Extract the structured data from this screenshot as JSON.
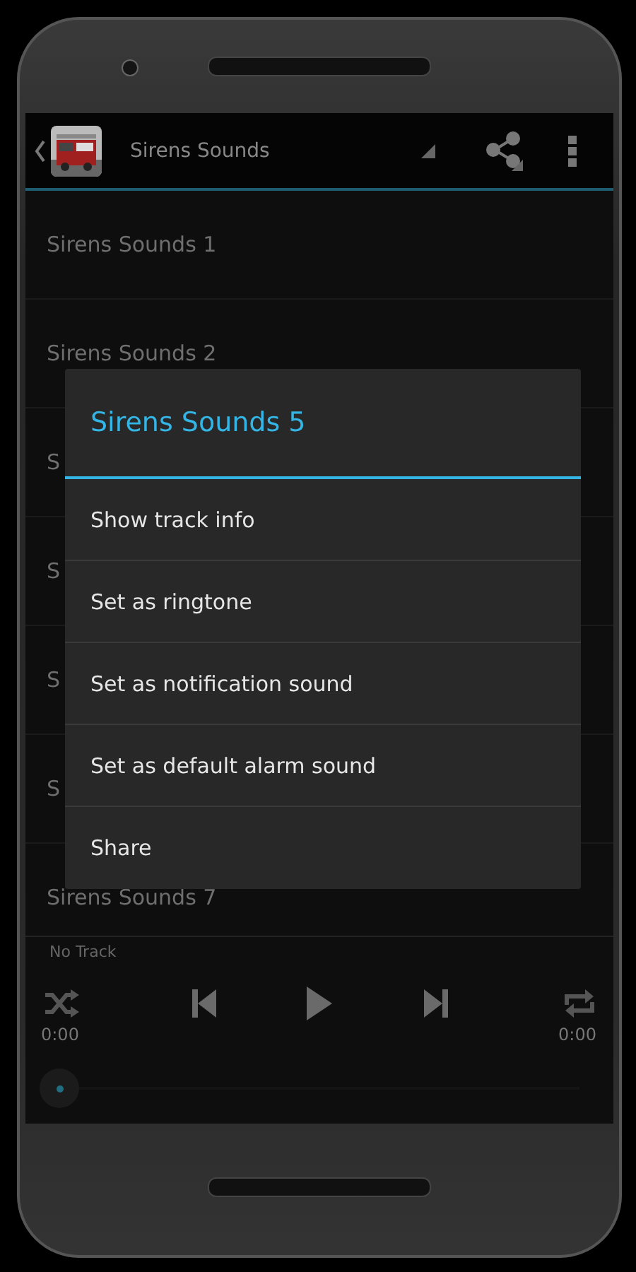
{
  "app_bar": {
    "title": "Sirens Sounds"
  },
  "tracks": [
    {
      "title": "Sirens Sounds 1"
    },
    {
      "title": "Sirens Sounds 2"
    },
    {
      "title": "S"
    },
    {
      "title": "S"
    },
    {
      "title": "S"
    },
    {
      "title": "S"
    },
    {
      "title": "Sirens Sounds 7"
    }
  ],
  "dialog": {
    "title": "Sirens Sounds 5",
    "items": [
      "Show track info",
      "Set as ringtone",
      "Set as notification sound",
      "Set as default alarm sound",
      "Share"
    ]
  },
  "player": {
    "track": "No Track",
    "elapsed": "0:00",
    "duration": "0:00"
  }
}
